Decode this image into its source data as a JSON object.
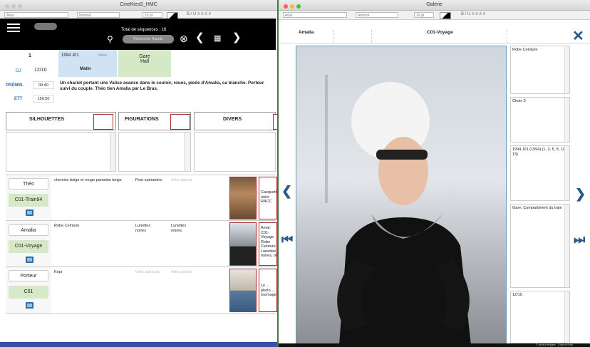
{
  "left_window": {
    "title": "CineKiesS_HMC",
    "format": {
      "font": "Arial",
      "style": "Normal",
      "size": "10 pt",
      "controls": "B / U  ≡ ≡ ≡ ≡"
    },
    "nav": {
      "total_label": "Total de séquences : 16",
      "search_placeholder": "Recherche Rapide"
    },
    "scene": {
      "number": "1",
      "day_label": "DJ",
      "date": "12/10",
      "episode": "1994 J01",
      "episode_status": "Idées",
      "time_of_day": "Matin",
      "location_line1": "Gare",
      "location_line2": "Hall",
      "duration_label_1": "PRÉMIN.",
      "duration_val_1": "00:40",
      "duration_label_2": "ETT",
      "duration_val_2": "150:50",
      "description": "Un chariot portant une Valise avance dans le couloir, roues, pieds d'Amalia, ca blanche. Porteur suivi du couple. Théo tien Amalia par Le Bras."
    },
    "panels": {
      "silhouettes": "SILHOUETTES",
      "figurations": "FIGURATIONS",
      "divers": "DIVERS"
    },
    "characters": [
      {
        "name": "Théo",
        "tag": "C01-Train94",
        "costume": "chemise beige et rouge pantalon beige",
        "accessories": "Post opératoire",
        "makeup": "Infos pièces",
        "note": "Casquette noire RACC"
      },
      {
        "name": "Amalia",
        "tag": "C01-Voyage",
        "costume": "Robe Ceinture",
        "accessories": "Lunettes noires",
        "makeup": "Lunettes noires",
        "note": "Amal: C01-Voyage Robe Ceinture Lunettes noires, ok"
      },
      {
        "name": "Porteur",
        "tag": "C01",
        "costume": "Kepi",
        "accessories": "Infos autocats",
        "makeup": "Infos pièces",
        "note": "Le ... photo ... tournage"
      }
    ]
  },
  "right_window": {
    "title": "Galerie",
    "format": {
      "font": "Arial",
      "style": "Normal",
      "size": "10 pt",
      "controls": "B / U  ≡ ≡ ≡ ≡"
    },
    "header": {
      "character": "Amalia",
      "costume_tag": "C01-Voyage"
    },
    "side_cells": [
      "Robe Ceinture",
      "Choix 3",
      "1994 J01 (1994) (1, 3, 5, 8, 10, 13)",
      "Gare, Compartiment du train",
      "12/10"
    ],
    "footer": "© photo/images - Kiss et Kiss"
  },
  "colors": {
    "background": "#3f7a3c",
    "green_tag": "#d6e9c6",
    "blue_cell": "#cfe3f5",
    "red_frame": "#a33333",
    "nav_black": "#000000"
  }
}
